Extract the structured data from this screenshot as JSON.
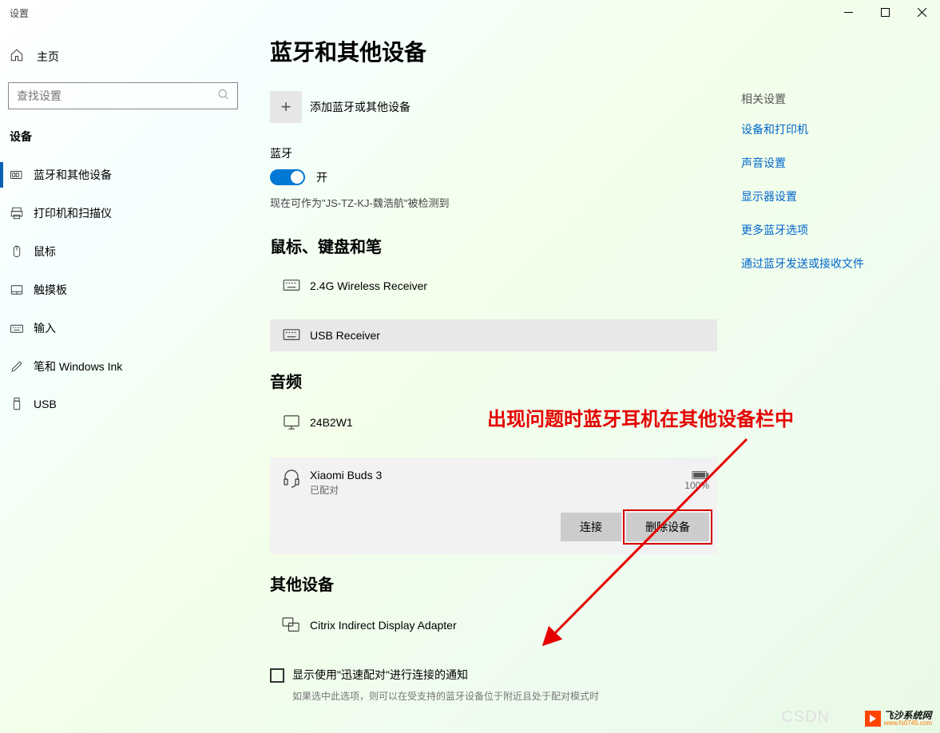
{
  "window_title": "设置",
  "home_label": "主页",
  "search": {
    "placeholder": "查找设置"
  },
  "group_label": "设备",
  "sidebar": {
    "items": [
      {
        "label": "蓝牙和其他设备",
        "active": true
      },
      {
        "label": "打印机和扫描仪"
      },
      {
        "label": "鼠标"
      },
      {
        "label": "触摸板"
      },
      {
        "label": "输入"
      },
      {
        "label": "笔和 Windows Ink"
      },
      {
        "label": "USB"
      }
    ]
  },
  "page_title": "蓝牙和其他设备",
  "add_device_label": "添加蓝牙或其他设备",
  "bluetooth_label": "蓝牙",
  "toggle_on": "开",
  "detection_text": "现在可作为\"JS-TZ-KJ-魏浩航\"被检测到",
  "sections": {
    "mkp": {
      "title": "鼠标、键盘和笔",
      "devices": [
        {
          "name": "2.4G Wireless Receiver"
        },
        {
          "name": "USB Receiver"
        }
      ]
    },
    "audio": {
      "title": "音频",
      "devices": [
        {
          "name": "24B2W1"
        },
        {
          "name": "Xiaomi Buds 3",
          "status": "已配对",
          "battery_pct": "100%",
          "connect_label": "连接",
          "remove_label": "删除设备"
        }
      ]
    },
    "other": {
      "title": "其他设备",
      "devices": [
        {
          "name": "Citrix Indirect Display Adapter"
        }
      ]
    }
  },
  "quick_pair_label": "显示使用\"迅速配对\"进行连接的通知",
  "quick_pair_desc": "如果选中此选项，则可以在受支持的蓝牙设备位于附近且处于配对模式时",
  "related": {
    "heading": "相关设置",
    "links": [
      "设备和打印机",
      "声音设置",
      "显示器设置",
      "更多蓝牙选项",
      "通过蓝牙发送或接收文件"
    ]
  },
  "annotation_text": "出现问题时蓝牙耳机在其他设备栏中",
  "watermark": "CSDN",
  "brand": {
    "name": "飞沙系统网",
    "url": "www.fs0745.com"
  }
}
